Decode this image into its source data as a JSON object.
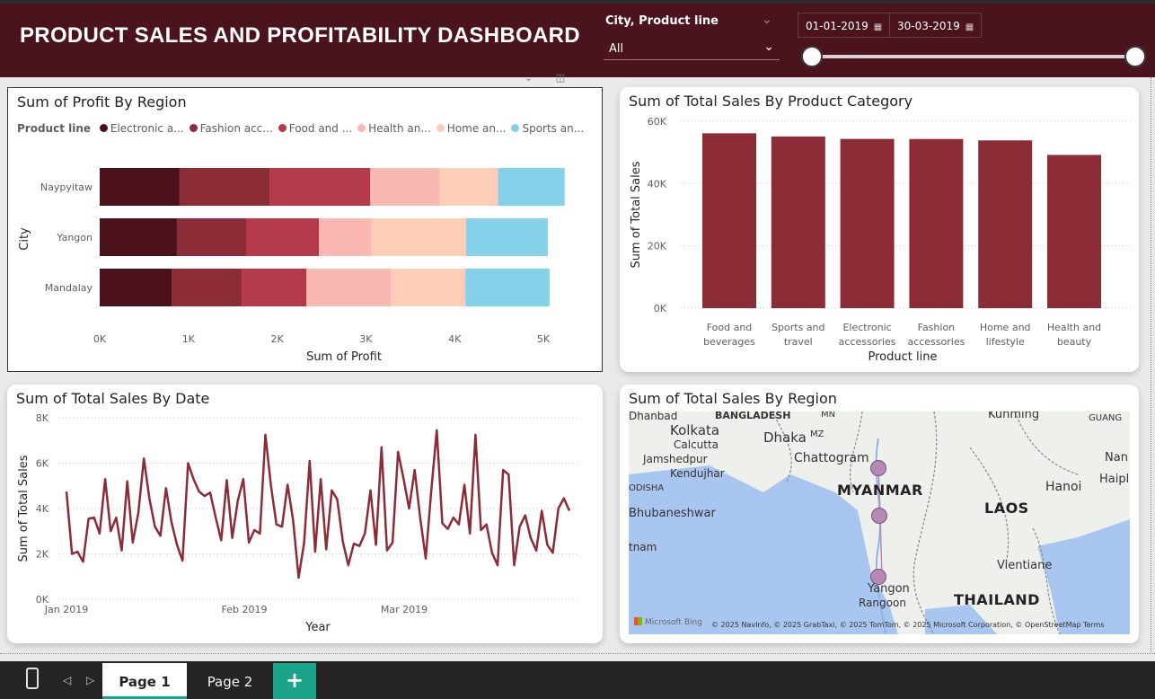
{
  "header": {
    "title": "PRODUCT SALES AND PROFITABILITY DASHBOARD",
    "slicer_title": "City, Product line",
    "slicer_value": "All",
    "date_start": "01-01-2019",
    "date_end": "30-03-2019",
    "range_slider": {
      "start_fraction": 0.0,
      "end_fraction": 1.0
    },
    "colors": {
      "header_bg": "#4a131e",
      "accent": "#8b2c37"
    }
  },
  "profit_by_region": {
    "title": "Sum of Profit By Region",
    "legend_label": "Product line",
    "legend_items": [
      {
        "label": "Electronic a...",
        "color": "#4a111c"
      },
      {
        "label": "Fashion acc...",
        "color": "#8b2c37"
      },
      {
        "label": "Food and ...",
        "color": "#b53a49"
      },
      {
        "label": "Health an...",
        "color": "#fbb7b1"
      },
      {
        "label": "Home an...",
        "color": "#fdcdb7"
      },
      {
        "label": "Sports an...",
        "color": "#86d1ea"
      }
    ],
    "chart_data": {
      "type": "bar",
      "orientation": "horizontal",
      "stacked": true,
      "categories": [
        "Naypyitaw",
        "Yangon",
        "Mandalay"
      ],
      "series": [
        {
          "name": "Electronic a...",
          "values": [
            900,
            870,
            810
          ]
        },
        {
          "name": "Fashion acc...",
          "values": [
            1020,
            780,
            790
          ]
        },
        {
          "name": "Food and ...",
          "values": [
            1130,
            820,
            730
          ]
        },
        {
          "name": "Health an...",
          "values": [
            780,
            590,
            950
          ]
        },
        {
          "name": "Home an...",
          "values": [
            660,
            1070,
            840
          ]
        },
        {
          "name": "Sports an...",
          "values": [
            750,
            920,
            950
          ]
        }
      ],
      "xlabel": "Sum of Profit",
      "ylabel": "City",
      "xlim": [
        0,
        5300
      ],
      "xticks": [
        "0K",
        "1K",
        "2K",
        "3K",
        "4K",
        "5K"
      ],
      "grid": false
    }
  },
  "sales_by_category": {
    "title": "Sum of Total Sales By Product Category",
    "chart_data": {
      "type": "bar",
      "categories": [
        "Food and beverages",
        "Sports and travel",
        "Electronic accessories",
        "Fashion accessories",
        "Home and lifestyle",
        "Health and beauty"
      ],
      "category_lines": [
        [
          "Food and",
          "beverages"
        ],
        [
          "Sports and",
          "travel"
        ],
        [
          "Electronic",
          "accessories"
        ],
        [
          "Fashion",
          "accessories"
        ],
        [
          "Home and",
          "lifestyle"
        ],
        [
          "Health and",
          "beauty"
        ]
      ],
      "values": [
        56145,
        55123,
        54338,
        54306,
        53862,
        49194
      ],
      "xlabel": "Product line",
      "ylabel": "Sum of Total Sales",
      "ylim": [
        0,
        60000
      ],
      "yticks": [
        "0K",
        "20K",
        "40K",
        "60K"
      ],
      "grid": true,
      "color": "#8b2c37"
    }
  },
  "sales_by_date": {
    "title": "Sum of Total Sales By Date",
    "chart_data": {
      "type": "line",
      "x_start": "2019-01-01",
      "x_end": "2019-03-30",
      "x_tick_labels": [
        "Jan 2019",
        "Feb 2019",
        "Mar 2019"
      ],
      "values": [
        4750,
        2000,
        2100,
        1650,
        3550,
        3600,
        2900,
        5300,
        3000,
        3600,
        2150,
        5200,
        2500,
        3800,
        6200,
        4450,
        3200,
        2800,
        4900,
        3400,
        2400,
        1700,
        6000,
        5300,
        4750,
        4550,
        4700,
        3600,
        2600,
        5250,
        2700,
        4350,
        5300,
        2500,
        3050,
        2900,
        7250,
        5000,
        3300,
        3200,
        5050,
        3500,
        950,
        2500,
        6100,
        2100,
        5300,
        2200,
        4800,
        4400,
        2550,
        1500,
        2450,
        2350,
        2900,
        4800,
        2400,
        6700,
        2150,
        2500,
        6500,
        5300,
        4000,
        5700,
        3600,
        1800,
        4800,
        7450,
        3350,
        3100,
        3600,
        3300,
        5050,
        2900,
        7250,
        3050,
        3300,
        2050,
        1500,
        5700,
        5500,
        1500,
        3200,
        3700,
        2700,
        2150,
        3900,
        2400,
        2050,
        4000,
        4450,
        3900
      ],
      "xlabel": "Year",
      "ylabel": "Sum of Total Sales",
      "ylim": [
        0,
        8000
      ],
      "yticks": [
        "0K",
        "2K",
        "4K",
        "6K",
        "8K"
      ],
      "grid": true,
      "color": "#8b2c37"
    }
  },
  "sales_by_region": {
    "title": "Sum of Total Sales By Region",
    "map_labels": [
      "BANGLADESH",
      "Dhaka",
      "Kolkata",
      "Calcutta",
      "Jamshedpur",
      "Kendujhar",
      "ODISHA",
      "Bhubaneshwar",
      "Chattogram",
      "MYANMAR",
      "LAOS",
      "Hanoi",
      "Kunming",
      "Vientiane",
      "THAILAND",
      "Yangon",
      "Rangoon",
      "Dhanbad",
      "MZ",
      "MN",
      "GUANG",
      "Nan",
      "Haipl",
      "tnam"
    ],
    "credit": "© 2025 NavInfo, © 2025 GrabTaxi, © 2025 TomTom, © 2025 Microsoft Corporation, © OpenStreetMap  Terms",
    "bing_label": "Microsoft Bing",
    "city_points": [
      {
        "city": "Mandalay"
      },
      {
        "city": "Naypyitaw"
      },
      {
        "city": "Yangon"
      }
    ]
  },
  "tabs": {
    "pages": [
      "Page 1",
      "Page 2"
    ],
    "active_index": 0,
    "add_label": "+"
  }
}
